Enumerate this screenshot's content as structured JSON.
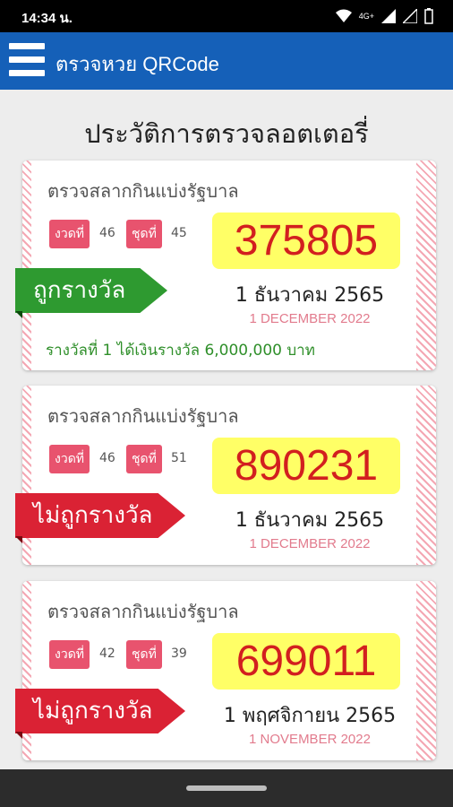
{
  "status": {
    "time": "14:34 น.",
    "network": "4G+"
  },
  "app": {
    "title": "ตรวจหวย QRCode"
  },
  "page": {
    "title": "ประวัติการตรวจลอตเตอรี่"
  },
  "colors": {
    "appbar": "#1560b8",
    "win": "#2e9a30",
    "lose": "#da2234",
    "ticket_bg": "#ffff66",
    "ticket_text": "#d21f1f"
  },
  "cards": [
    {
      "heading": "ตรวจสลากกินแบ่งรัฐบาล",
      "draw_label": "งวดที่",
      "draw_value": "46",
      "set_label": "ชุดที่",
      "set_value": "45",
      "number": "375805",
      "status": "ถูกรางวัล",
      "thai_date": "1 ธันวาคม 2565",
      "eng_date": "1 DECEMBER 2022",
      "prize": "รางวัลที่ 1 ได้เงินรางวัล 6,000,000 บาท"
    },
    {
      "heading": "ตรวจสลากกินแบ่งรัฐบาล",
      "draw_label": "งวดที่",
      "draw_value": "46",
      "set_label": "ชุดที่",
      "set_value": "51",
      "number": "890231",
      "status": "ไม่ถูกรางวัล",
      "thai_date": "1 ธันวาคม 2565",
      "eng_date": "1 DECEMBER 2022"
    },
    {
      "heading": "ตรวจสลากกินแบ่งรัฐบาล",
      "draw_label": "งวดที่",
      "draw_value": "42",
      "set_label": "ชุดที่",
      "set_value": "39",
      "number": "699011",
      "status": "ไม่ถูกรางวัล",
      "thai_date": "1 พฤศจิกายน 2565",
      "eng_date": "1 NOVEMBER 2022"
    }
  ]
}
